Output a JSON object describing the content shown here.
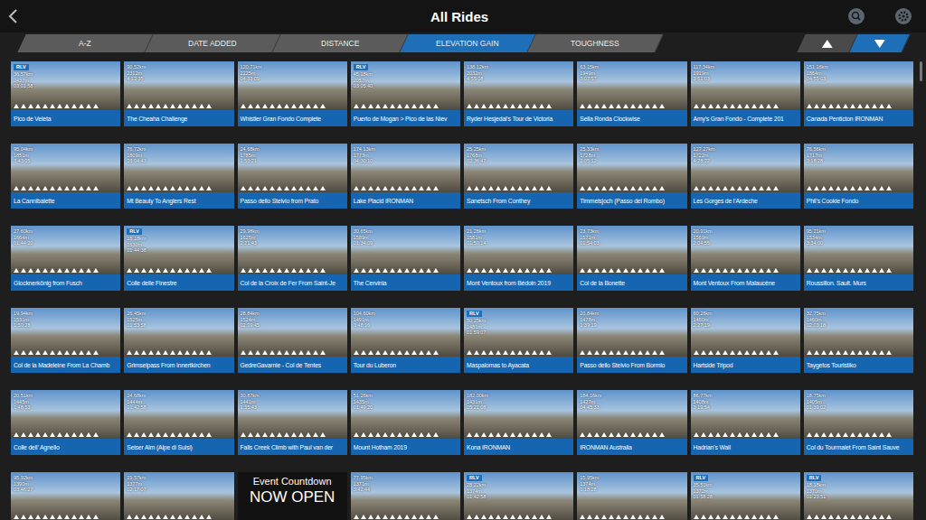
{
  "window": {
    "title": "All Rides"
  },
  "sort_tabs": [
    {
      "label": "A-Z",
      "selected": false
    },
    {
      "label": "DATE ADDED",
      "selected": false
    },
    {
      "label": "DISTANCE",
      "selected": false
    },
    {
      "label": "ELEVATION GAIN",
      "selected": true
    },
    {
      "label": "TOUGHNESS",
      "selected": false
    }
  ],
  "sort_order": {
    "descending": true
  },
  "rides": [
    {
      "kind": "ride",
      "badge": "RLV",
      "distance": "36.57km",
      "elevation": "2437m",
      "duration": "03:01:58",
      "title": "Pico de Veleta"
    },
    {
      "kind": "ride",
      "distance": "90.52km",
      "elevation": "2312m",
      "duration": "4:12:35",
      "title": "The Cheaha Challenge"
    },
    {
      "kind": "ride",
      "distance": "120.71km",
      "elevation": "2225m",
      "duration": "04:33:09",
      "title": "Whistler Gran Fondo Complete"
    },
    {
      "kind": "ride",
      "badge": "RLV",
      "distance": "45.18km",
      "elevation": "2057m",
      "duration": "03:05:40",
      "title": "Puerto de Mogan > Pico de las Niev"
    },
    {
      "kind": "ride",
      "distance": "138.12km",
      "elevation": "2032m",
      "duration": "4:55:08",
      "title": "Ryder Hesjedal's Tour de Victoria"
    },
    {
      "kind": "ride",
      "distance": "63.15km",
      "elevation": "1949m",
      "duration": "3:07:57",
      "title": "Sella Ronda Clockwise"
    },
    {
      "kind": "ride",
      "distance": "117.34km",
      "elevation": "1919m",
      "duration": "3:51:03",
      "title": "Amy's Gran Fondo  - Complete 201"
    },
    {
      "kind": "ride",
      "distance": "151.16km",
      "elevation": "1864m",
      "duration": "04:55:03",
      "title": "Canada Penticton IRONMAN"
    },
    {
      "kind": "ride",
      "distance": "95.04km",
      "elevation": "1851m",
      "duration": "3:43:05",
      "title": "La Cannibalette"
    },
    {
      "kind": "ride",
      "distance": "76.72km",
      "elevation": "1809m",
      "duration": "03:04:43",
      "title": "Mt Beauty To Anglers Rest"
    },
    {
      "kind": "ride",
      "distance": "24.68km",
      "elevation": "1785m",
      "duration": "1:50:21",
      "title": "Passo dello Stelvio from Prato"
    },
    {
      "kind": "ride",
      "distance": "174.13km",
      "elevation": "1773m",
      "duration": "04:30:10",
      "title": "Lake Placid IRONMAN"
    },
    {
      "kind": "ride",
      "distance": "25.25km",
      "elevation": "1768m",
      "duration": "02:36:47",
      "title": "Sanetsch From Conthey"
    },
    {
      "kind": "ride",
      "distance": "25.33km",
      "elevation": "1728m",
      "duration": "2:05:12",
      "title": "Timmelsjoch (Passo del Rombo)"
    },
    {
      "kind": "ride",
      "distance": "127.27km",
      "elevation": "1722m",
      "duration": "4:28:22",
      "title": "Les Gorges de l'Ardeche"
    },
    {
      "kind": "ride",
      "distance": "76.56km",
      "elevation": "1717m",
      "duration": "3:18:28",
      "title": "Phil's Cookie Fondo"
    },
    {
      "kind": "ride",
      "distance": "27.60km",
      "elevation": "1664m",
      "duration": "01:44:20",
      "title": "Glocknerkönig from Fusch"
    },
    {
      "kind": "ride",
      "badge": "RLV",
      "distance": "18.18km",
      "elevation": "1630m",
      "duration": "01:44:38",
      "title": "Colle delle Finestre"
    },
    {
      "kind": "ride",
      "distance": "29.98km",
      "elevation": "1625m",
      "duration": "2:21:43",
      "title": "Col de la Croix de Fer From Saint-Je"
    },
    {
      "kind": "ride",
      "distance": "30.65km",
      "elevation": "1589m",
      "duration": "01:34:09",
      "title": "The Cervinia"
    },
    {
      "kind": "ride",
      "distance": "21.28km",
      "elevation": "1581m",
      "duration": "01:50:14",
      "title": "Mont Ventoux from Bédoin 2019"
    },
    {
      "kind": "ride",
      "distance": "23.73km",
      "elevation": "1571m",
      "duration": "01:54:03",
      "title": "Col de la Bonette"
    },
    {
      "kind": "ride",
      "distance": "20.91km",
      "elevation": "1569m",
      "duration": "2:04:55",
      "title": "Mont Ventoux From Malaucène"
    },
    {
      "kind": "ride",
      "distance": "95.21km",
      "elevation": "1534m",
      "duration": "3:34:00",
      "title": "Roussillon. Sault. Murs"
    },
    {
      "kind": "ride",
      "distance": "19.94km",
      "elevation": "1531m",
      "duration": "1:50:28",
      "title": "Col de la Madeleine From La Chamb"
    },
    {
      "kind": "ride",
      "distance": "26.45km",
      "elevation": "1525m",
      "duration": "01:53:58",
      "title": "Grimselpass From Innertkirchen"
    },
    {
      "kind": "ride",
      "distance": "28.84km",
      "elevation": "1524m",
      "duration": "02:09:45",
      "title": "GedreGavarnie - Col de Tentes"
    },
    {
      "kind": "ride",
      "distance": "104.60km",
      "elevation": "1491m",
      "duration": "3:48:16",
      "title": "Tour du Luberon"
    },
    {
      "kind": "ride",
      "badge": "RLV",
      "distance": "50.25km",
      "elevation": "1481m",
      "duration": "01:59:07",
      "title": "Maspalomas to Ayacata"
    },
    {
      "kind": "ride",
      "distance": "20.84km",
      "elevation": "1478m",
      "duration": "1:39:19",
      "title": "Passo dello Stelvio From Bormio"
    },
    {
      "kind": "ride",
      "distance": "60.26km",
      "elevation": "1460m",
      "duration": "2:27:19",
      "title": "Hartside Tripod"
    },
    {
      "kind": "ride",
      "distance": "32.75km",
      "elevation": "1460m",
      "duration": "02:03:18",
      "title": "Taygetos Touristiko"
    },
    {
      "kind": "ride",
      "distance": "20.51km",
      "elevation": "1445m",
      "duration": "1:48:53",
      "title": "Colle dell' Agnello"
    },
    {
      "kind": "ride",
      "distance": "24.68km",
      "elevation": "1444m",
      "duration": "01:42:58",
      "title": "Seiser Alm (Alpe di Suisi)"
    },
    {
      "kind": "ride",
      "distance": "30.87km",
      "elevation": "1441m",
      "duration": "1:35:43",
      "title": "Falls Creek Climb with Paul van der"
    },
    {
      "kind": "ride",
      "distance": "51.26km",
      "elevation": "1435m",
      "duration": "01:49:20",
      "title": "Mount Hotham 2019"
    },
    {
      "kind": "ride",
      "distance": "182.00km",
      "elevation": "1431m",
      "duration": "05:21:08",
      "title": "Kona IRONMAN"
    },
    {
      "kind": "ride",
      "distance": "184.16km",
      "elevation": "1427m",
      "duration": "04:45:33",
      "title": "IRONMAN Australia"
    },
    {
      "kind": "ride",
      "distance": "86.77km",
      "elevation": "1408m",
      "duration": "3:19:54",
      "title": "Hadrian's Wall"
    },
    {
      "kind": "ride",
      "distance": "18.75km",
      "elevation": "1405m",
      "duration": "01:39:02",
      "title": "Col du Tourmalet From Saint Sauve"
    },
    {
      "kind": "ride",
      "distance": "95.92km",
      "elevation": "1390m",
      "duration": "03:46:27"
    },
    {
      "kind": "ride",
      "distance": "19.57km",
      "elevation": "1377m",
      "duration": "02:17:07"
    },
    {
      "kind": "event",
      "lines": [
        "Event Countdown",
        "NOW OPEN"
      ]
    },
    {
      "kind": "ride",
      "distance": "77.95km",
      "elevation": "1371m",
      "duration": "3:42:44"
    },
    {
      "kind": "ride",
      "badge": "RLV",
      "distance": "28.22km",
      "elevation": "1374m",
      "duration": "01:42:58"
    },
    {
      "kind": "ride",
      "distance": "15.95km",
      "elevation": "1374m",
      "duration": "1:18:28"
    },
    {
      "kind": "ride",
      "badge": "RLV",
      "distance": "35.51km",
      "elevation": "1372m",
      "duration": "01:58:28"
    },
    {
      "kind": "ride",
      "badge": "RLV",
      "distance": "18.18km",
      "elevation": "1370m",
      "duration": "01:23:51"
    }
  ]
}
